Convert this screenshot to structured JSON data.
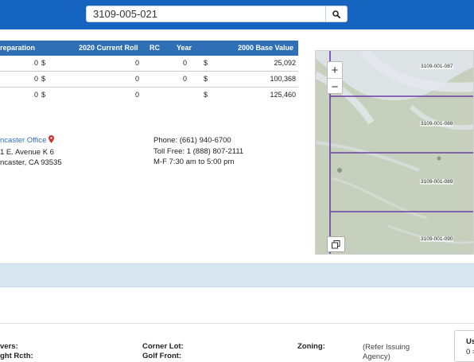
{
  "search": {
    "value": "3109-005-021"
  },
  "values_table": {
    "headers": [
      "reparation",
      "2020 Current Roll",
      "RC",
      "Year",
      "2000 Base Value"
    ],
    "rows": [
      {
        "preparation": "0",
        "current_sym": "$",
        "current": "0",
        "rc": "0",
        "base_sym": "$",
        "base": "25,092"
      },
      {
        "preparation": "0",
        "current_sym": "$",
        "current": "0",
        "rc": "0",
        "base_sym": "$",
        "base": "100,368"
      },
      {
        "preparation": "0",
        "current_sym": "$",
        "current": "0",
        "rc": "",
        "base_sym": "$",
        "base": "125,460"
      }
    ]
  },
  "office": {
    "name": "ncaster Office",
    "address1": "1 E. Avenue K 6",
    "address2": "ncaster, CA 93535",
    "phone": "Phone: (661) 940-6700",
    "tollfree": "Toll Free: 1 (888) 807-2111",
    "hours": "M-F 7:30 am to 5:00 pm"
  },
  "map": {
    "parcels": [
      "3109-001-087",
      "3109-001-088",
      "3109-001-089",
      "3109-001-090"
    ],
    "zoom_in": "+",
    "zoom_out": "−"
  },
  "details": {
    "owners_label": "vers:",
    "owners_label2": "ght Rcth:",
    "corner_lot_label": "Corner Lot:",
    "golf_front_label": "Golf Front:",
    "zoning_label": "Zoning:",
    "zoning_value": "(Refer Issuing",
    "zoning_value2": "Agency)",
    "use_label": "Us",
    "use_value": "0 ="
  }
}
